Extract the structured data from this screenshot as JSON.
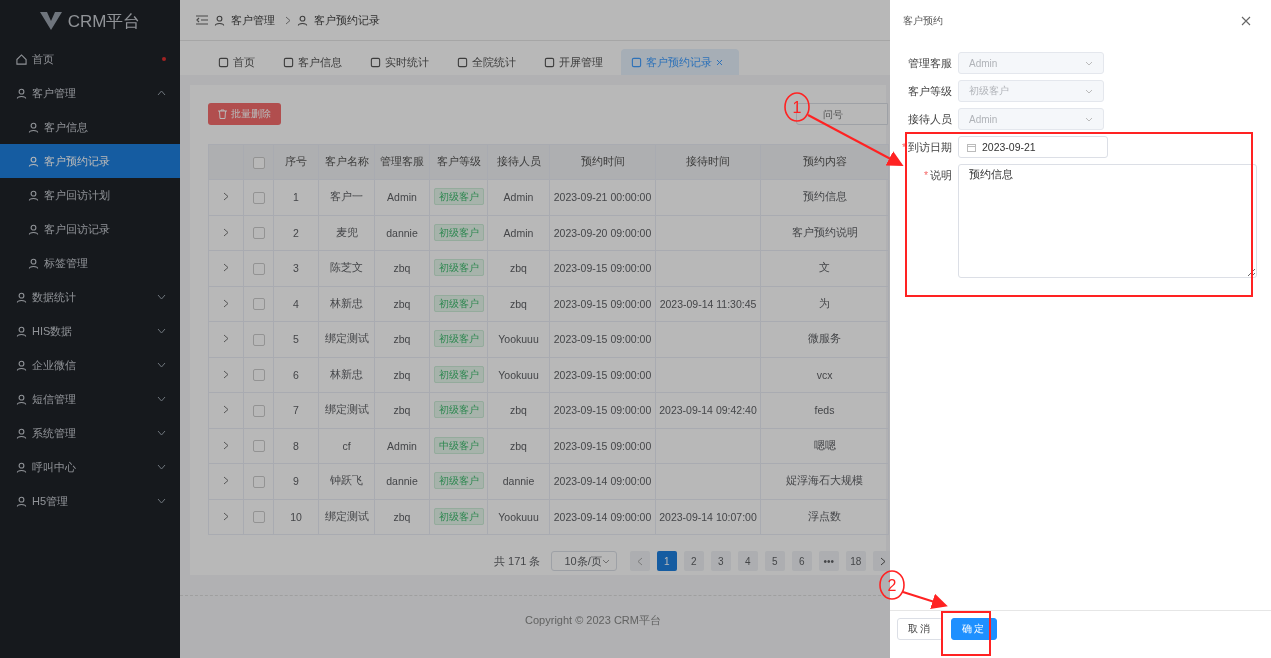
{
  "sidebar": {
    "logo": "CRM平台",
    "items": [
      {
        "label": "首页",
        "badge_dot": true
      },
      {
        "label": "客户管理",
        "expanded": true,
        "children": [
          {
            "label": "客户信息",
            "selected": false
          },
          {
            "label": "客户预约记录",
            "selected": true
          },
          {
            "label": "客户回访计划",
            "selected": false
          },
          {
            "label": "客户回访记录",
            "selected": false
          },
          {
            "label": "标签管理",
            "selected": false
          }
        ]
      },
      {
        "label": "数据统计",
        "expanded": false
      },
      {
        "label": "HIS数据",
        "expanded": false
      },
      {
        "label": "企业微信",
        "expanded": false
      },
      {
        "label": "短信管理",
        "expanded": false
      },
      {
        "label": "系统管理",
        "expanded": false
      },
      {
        "label": "呼叫中心",
        "expanded": false
      },
      {
        "label": "H5管理",
        "expanded": false
      }
    ]
  },
  "breadcrumb": [
    "客户管理",
    "客户预约记录"
  ],
  "tabs": [
    {
      "label": "首页",
      "selected": false
    },
    {
      "label": "客户信息",
      "selected": false
    },
    {
      "label": "实时统计",
      "selected": false
    },
    {
      "label": "全院统计",
      "selected": false
    },
    {
      "label": "开屏管理",
      "selected": false
    },
    {
      "label": "客户预约记录",
      "selected": true
    }
  ],
  "toolbar": {
    "delete_button": "批量删除",
    "search": {
      "placeholder": "问号"
    }
  },
  "table": {
    "select_all": false,
    "columns": [
      "序号",
      "客户名称",
      "管理客服",
      "客户等级",
      "接待人员",
      "预约时间",
      "接待时间",
      "预约内容"
    ],
    "rows": [
      {
        "checked": false,
        "no": "1",
        "name": "客户一",
        "manager": "Admin",
        "level": "初级客户",
        "receiver": "Admin",
        "booked": "2023-09-21 00:00:00",
        "received": "",
        "content": "预约信息"
      },
      {
        "checked": false,
        "no": "2",
        "name": "麦兜",
        "manager": "dannie",
        "level": "初级客户",
        "receiver": "Admin",
        "booked": "2023-09-20 09:00:00",
        "received": "",
        "content": "客户预约说明"
      },
      {
        "checked": false,
        "no": "3",
        "name": "陈芝文",
        "manager": "zbq",
        "level": "初级客户",
        "receiver": "zbq",
        "booked": "2023-09-15 09:00:00",
        "received": "",
        "content": "文"
      },
      {
        "checked": false,
        "no": "4",
        "name": "林新忠",
        "manager": "zbq",
        "level": "初级客户",
        "receiver": "zbq",
        "booked": "2023-09-15 09:00:00",
        "received": "2023-09-14 11:30:45",
        "content": "为"
      },
      {
        "checked": false,
        "no": "5",
        "name": "绑定测试",
        "manager": "zbq",
        "level": "初级客户",
        "receiver": "Yookuuu",
        "booked": "2023-09-15 09:00:00",
        "received": "",
        "content": "微服务"
      },
      {
        "checked": false,
        "no": "6",
        "name": "林新忠",
        "manager": "zbq",
        "level": "初级客户",
        "receiver": "Yookuuu",
        "booked": "2023-09-15 09:00:00",
        "received": "",
        "content": "vcx"
      },
      {
        "checked": false,
        "no": "7",
        "name": "绑定测试",
        "manager": "zbq",
        "level": "初级客户",
        "receiver": "zbq",
        "booked": "2023-09-15 09:00:00",
        "received": "2023-09-14 09:42:40",
        "content": "feds"
      },
      {
        "checked": false,
        "no": "8",
        "name": "cf",
        "manager": "Admin",
        "level": "中级客户",
        "receiver": "zbq",
        "booked": "2023-09-15 09:00:00",
        "received": "",
        "content": "嗯嗯"
      },
      {
        "checked": false,
        "no": "9",
        "name": "钟跃飞",
        "manager": "dannie",
        "level": "初级客户",
        "receiver": "dannie",
        "booked": "2023-09-14 09:00:00",
        "received": "",
        "content": "娖浮海石大规模"
      },
      {
        "checked": false,
        "no": "10",
        "name": "绑定测试",
        "manager": "zbq",
        "level": "初级客户",
        "receiver": "Yookuuu",
        "booked": "2023-09-14 09:00:00",
        "received": "2023-09-14 10:07:00",
        "content": "浮点数"
      }
    ]
  },
  "pagination": {
    "total": "共 171 条",
    "page_size": "10条/页",
    "pages": [
      {
        "label": "1",
        "selected": true
      },
      {
        "label": "2",
        "selected": false
      },
      {
        "label": "3",
        "selected": false
      },
      {
        "label": "4",
        "selected": false
      },
      {
        "label": "5",
        "selected": false
      },
      {
        "label": "6",
        "selected": false
      },
      {
        "label": "•••",
        "selected": false
      },
      {
        "label": "18",
        "selected": false
      }
    ]
  },
  "footer": "Copyright © 2023 CRM平台",
  "drawer": {
    "title": "客户预约",
    "fields": [
      {
        "kind": "select",
        "label": "管理客服",
        "value": "Admin",
        "disabled": true
      },
      {
        "kind": "select",
        "label": "客户等级",
        "value": "初级客户",
        "disabled": true
      },
      {
        "kind": "select",
        "label": "接待人员",
        "value": "Admin",
        "disabled": true
      },
      {
        "kind": "date",
        "label": "到访日期",
        "value": "2023-09-21",
        "disabled": false,
        "required_mark": "*"
      },
      {
        "kind": "textarea",
        "label": "说明",
        "value": "预约信息",
        "disabled": false,
        "required_mark": "*"
      }
    ],
    "buttons": [
      {
        "label": "取消",
        "kind": "default"
      },
      {
        "label": "确定",
        "kind": "primary"
      }
    ]
  },
  "annotations": [
    {
      "label": "1"
    },
    {
      "label": "2"
    }
  ]
}
